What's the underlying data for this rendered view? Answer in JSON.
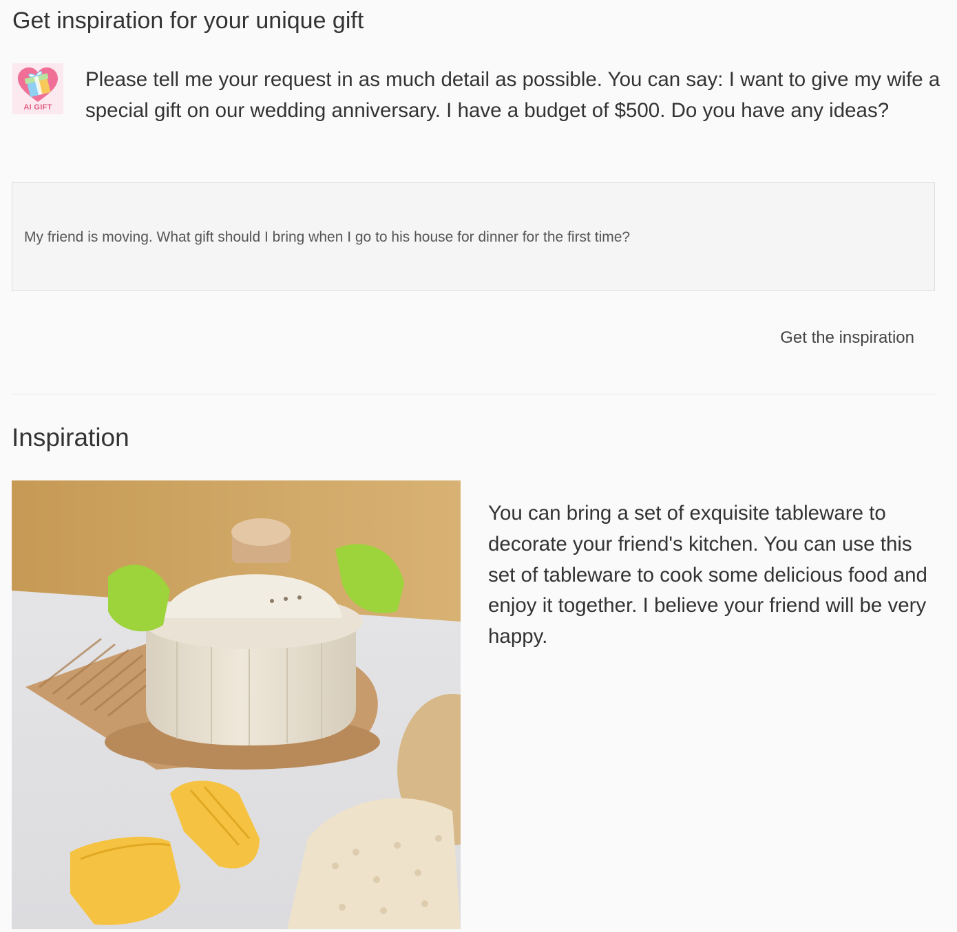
{
  "header": {
    "title": "Get inspiration for your unique gift"
  },
  "assistant": {
    "logo_text": "AI GIFT",
    "intro": "Please tell me your request in as much detail as possible. You can say: I want to give my wife a special gift on our wedding anniversary. I have a budget of $500. Do you have any ideas?"
  },
  "prompt": {
    "value": "My friend is moving. What gift should I bring when I go to his house for dinner for the first time?"
  },
  "actions": {
    "submit_label": "Get the inspiration"
  },
  "result": {
    "title": "Inspiration",
    "image_icon": "casserole-pot-photo",
    "text": "You can bring a set of exquisite tableware to decorate your friend's kitchen. You can use this set of tableware to cook some delicious food and enjoy it together. I believe your friend will be very happy."
  },
  "colors": {
    "background": "#fafafa",
    "text": "#333333",
    "logo_pink": "#e2577d",
    "input_bg": "#f5f5f5"
  }
}
